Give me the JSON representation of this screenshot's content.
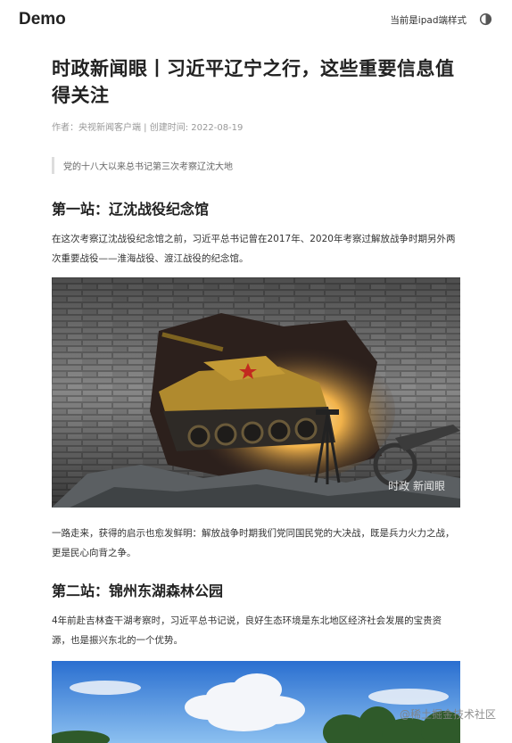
{
  "header": {
    "brand": "Demo",
    "mode_label": "当前是ipad端样式",
    "theme_icon": "half-moon-icon"
  },
  "article": {
    "title": "时政新闻眼丨习近平辽宁之行，这些重要信息值得关注",
    "meta": "作者：央视新闻客户端 | 创建时间: 2022-08-19",
    "quote": "党的十八大以来总书记第三次考察辽沈大地",
    "section1": {
      "heading": "第一站：辽沈战役纪念馆",
      "para1": "在这次考察辽沈战役纪念馆之前，习近平总书记曾在2017年、2020年考察过解放战争时期另外两次重要战役——淮海战役、渡江战役的纪念馆。",
      "image_watermark": "时政 新闻眼",
      "para2": "一路走来，获得的启示也愈发鲜明：解放战争时期我们党同国民党的大决战，既是兵力火力之战，更是民心向背之争。"
    },
    "section2": {
      "heading": "第二站：锦州东湖森林公园",
      "para1": "4年前赴吉林查干湖考察时，习近平总书记说，良好生态环境是东北地区经济社会发展的宝贵资源，也是振兴东北的一个优势。"
    },
    "page_watermark": "@稀土掘金技术社区"
  }
}
